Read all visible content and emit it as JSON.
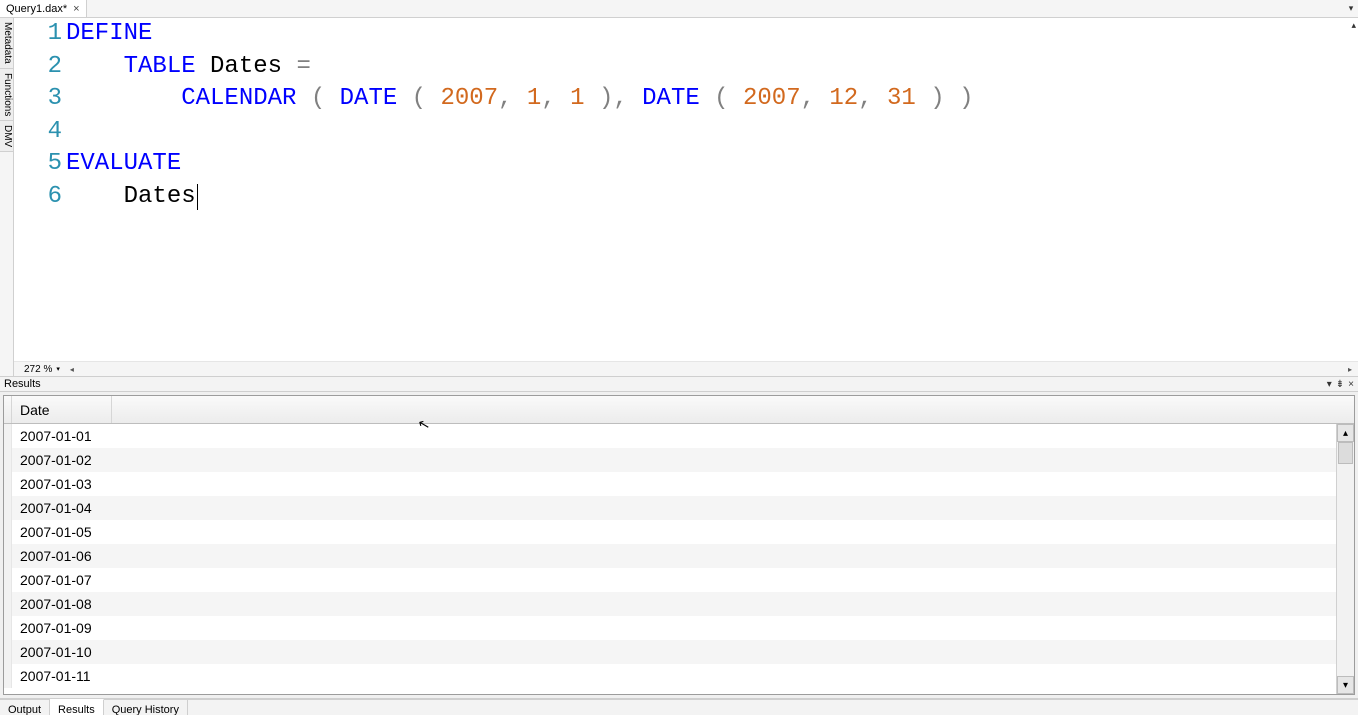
{
  "tabs": {
    "doc_name": "Query1.dax*",
    "close_glyph": "×",
    "dropdown_glyph": "▾"
  },
  "sidebar": {
    "tab1": "Metadata",
    "tab2": "Functions",
    "tab3": "DMV"
  },
  "editor": {
    "topright_glyph": "▴",
    "lines": [
      "1",
      "2",
      "3",
      "4",
      "5",
      "6"
    ],
    "code": {
      "define": "DEFINE",
      "table_kw": "TABLE",
      "dates_ident": "Dates",
      "eq": "=",
      "calendar": "CALENDAR",
      "date_fn": "DATE",
      "y1": "2007",
      "m1": "1",
      "d1": "1",
      "y2": "2007",
      "m2": "12",
      "d2": "31",
      "evaluate": "EVALUATE",
      "eval_ident": "Dates"
    }
  },
  "zoom": {
    "value": "272 %",
    "dd": "▾",
    "left_glyph": "◂",
    "right_glyph": "▸"
  },
  "results": {
    "title": "Results",
    "icon_dd": "▾",
    "icon_pin": "⇟",
    "icon_close": "×",
    "header": "Date",
    "rows": [
      "2007-01-01",
      "2007-01-02",
      "2007-01-03",
      "2007-01-04",
      "2007-01-05",
      "2007-01-06",
      "2007-01-07",
      "2007-01-08",
      "2007-01-09",
      "2007-01-10",
      "2007-01-11"
    ],
    "scroll_up": "▴",
    "scroll_down": "▾"
  },
  "bottom": {
    "output": "Output",
    "results": "Results",
    "history": "Query History"
  },
  "cursor_glyph": "↖"
}
